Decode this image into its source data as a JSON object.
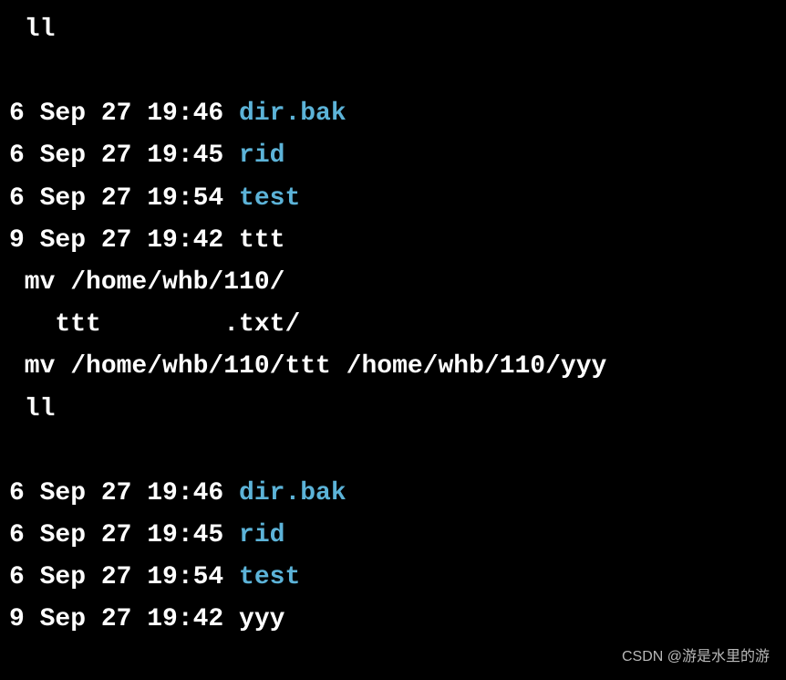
{
  "commands": {
    "ll1": " ll",
    "mv_partial": " mv /home/whb/110/",
    "tab_complete": "   ttt        .txt/",
    "mv_full": " mv /home/whb/110/ttt /home/whb/110/yyy",
    "ll2": " ll"
  },
  "listing1": {
    "row1": {
      "prefix": "6 Sep 27 19:46 ",
      "name": "dir.bak"
    },
    "row2": {
      "prefix": "6 Sep 27 19:45 ",
      "name": "rid"
    },
    "row3": {
      "prefix": "6 Sep 27 19:54 ",
      "name": "test"
    },
    "row4": {
      "prefix": "9 Sep 27 19:42 ",
      "name": "ttt"
    }
  },
  "listing2": {
    "row1": {
      "prefix": "6 Sep 27 19:46 ",
      "name": "dir.bak"
    },
    "row2": {
      "prefix": "6 Sep 27 19:45 ",
      "name": "rid"
    },
    "row3": {
      "prefix": "6 Sep 27 19:54 ",
      "name": "test"
    },
    "row4": {
      "prefix": "9 Sep 27 19:42 ",
      "name": "yyy"
    }
  },
  "watermark": "CSDN @游是水里的游"
}
